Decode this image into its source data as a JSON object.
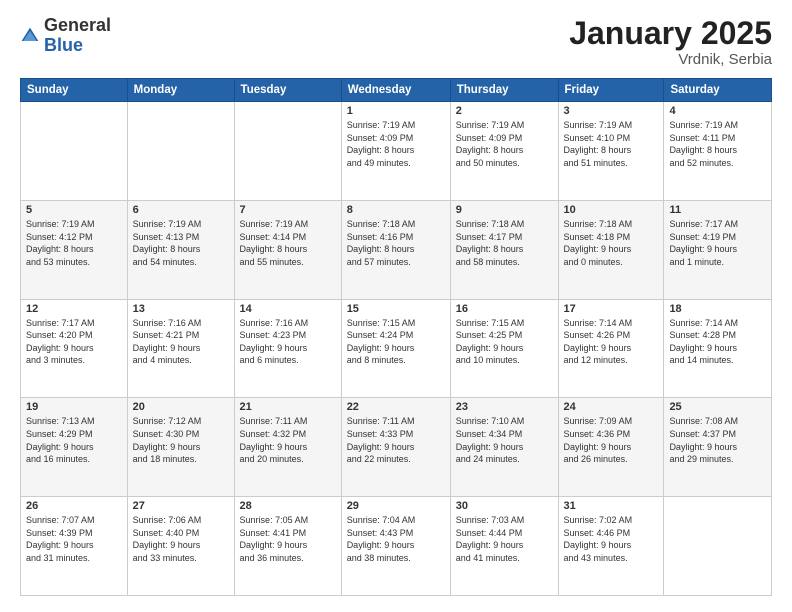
{
  "logo": {
    "general": "General",
    "blue": "Blue"
  },
  "header": {
    "month": "January 2025",
    "location": "Vrdnik, Serbia"
  },
  "weekdays": [
    "Sunday",
    "Monday",
    "Tuesday",
    "Wednesday",
    "Thursday",
    "Friday",
    "Saturday"
  ],
  "weeks": [
    [
      {
        "day": "",
        "info": ""
      },
      {
        "day": "",
        "info": ""
      },
      {
        "day": "",
        "info": ""
      },
      {
        "day": "1",
        "info": "Sunrise: 7:19 AM\nSunset: 4:09 PM\nDaylight: 8 hours\nand 49 minutes."
      },
      {
        "day": "2",
        "info": "Sunrise: 7:19 AM\nSunset: 4:09 PM\nDaylight: 8 hours\nand 50 minutes."
      },
      {
        "day": "3",
        "info": "Sunrise: 7:19 AM\nSunset: 4:10 PM\nDaylight: 8 hours\nand 51 minutes."
      },
      {
        "day": "4",
        "info": "Sunrise: 7:19 AM\nSunset: 4:11 PM\nDaylight: 8 hours\nand 52 minutes."
      }
    ],
    [
      {
        "day": "5",
        "info": "Sunrise: 7:19 AM\nSunset: 4:12 PM\nDaylight: 8 hours\nand 53 minutes."
      },
      {
        "day": "6",
        "info": "Sunrise: 7:19 AM\nSunset: 4:13 PM\nDaylight: 8 hours\nand 54 minutes."
      },
      {
        "day": "7",
        "info": "Sunrise: 7:19 AM\nSunset: 4:14 PM\nDaylight: 8 hours\nand 55 minutes."
      },
      {
        "day": "8",
        "info": "Sunrise: 7:18 AM\nSunset: 4:16 PM\nDaylight: 8 hours\nand 57 minutes."
      },
      {
        "day": "9",
        "info": "Sunrise: 7:18 AM\nSunset: 4:17 PM\nDaylight: 8 hours\nand 58 minutes."
      },
      {
        "day": "10",
        "info": "Sunrise: 7:18 AM\nSunset: 4:18 PM\nDaylight: 9 hours\nand 0 minutes."
      },
      {
        "day": "11",
        "info": "Sunrise: 7:17 AM\nSunset: 4:19 PM\nDaylight: 9 hours\nand 1 minute."
      }
    ],
    [
      {
        "day": "12",
        "info": "Sunrise: 7:17 AM\nSunset: 4:20 PM\nDaylight: 9 hours\nand 3 minutes."
      },
      {
        "day": "13",
        "info": "Sunrise: 7:16 AM\nSunset: 4:21 PM\nDaylight: 9 hours\nand 4 minutes."
      },
      {
        "day": "14",
        "info": "Sunrise: 7:16 AM\nSunset: 4:23 PM\nDaylight: 9 hours\nand 6 minutes."
      },
      {
        "day": "15",
        "info": "Sunrise: 7:15 AM\nSunset: 4:24 PM\nDaylight: 9 hours\nand 8 minutes."
      },
      {
        "day": "16",
        "info": "Sunrise: 7:15 AM\nSunset: 4:25 PM\nDaylight: 9 hours\nand 10 minutes."
      },
      {
        "day": "17",
        "info": "Sunrise: 7:14 AM\nSunset: 4:26 PM\nDaylight: 9 hours\nand 12 minutes."
      },
      {
        "day": "18",
        "info": "Sunrise: 7:14 AM\nSunset: 4:28 PM\nDaylight: 9 hours\nand 14 minutes."
      }
    ],
    [
      {
        "day": "19",
        "info": "Sunrise: 7:13 AM\nSunset: 4:29 PM\nDaylight: 9 hours\nand 16 minutes."
      },
      {
        "day": "20",
        "info": "Sunrise: 7:12 AM\nSunset: 4:30 PM\nDaylight: 9 hours\nand 18 minutes."
      },
      {
        "day": "21",
        "info": "Sunrise: 7:11 AM\nSunset: 4:32 PM\nDaylight: 9 hours\nand 20 minutes."
      },
      {
        "day": "22",
        "info": "Sunrise: 7:11 AM\nSunset: 4:33 PM\nDaylight: 9 hours\nand 22 minutes."
      },
      {
        "day": "23",
        "info": "Sunrise: 7:10 AM\nSunset: 4:34 PM\nDaylight: 9 hours\nand 24 minutes."
      },
      {
        "day": "24",
        "info": "Sunrise: 7:09 AM\nSunset: 4:36 PM\nDaylight: 9 hours\nand 26 minutes."
      },
      {
        "day": "25",
        "info": "Sunrise: 7:08 AM\nSunset: 4:37 PM\nDaylight: 9 hours\nand 29 minutes."
      }
    ],
    [
      {
        "day": "26",
        "info": "Sunrise: 7:07 AM\nSunset: 4:39 PM\nDaylight: 9 hours\nand 31 minutes."
      },
      {
        "day": "27",
        "info": "Sunrise: 7:06 AM\nSunset: 4:40 PM\nDaylight: 9 hours\nand 33 minutes."
      },
      {
        "day": "28",
        "info": "Sunrise: 7:05 AM\nSunset: 4:41 PM\nDaylight: 9 hours\nand 36 minutes."
      },
      {
        "day": "29",
        "info": "Sunrise: 7:04 AM\nSunset: 4:43 PM\nDaylight: 9 hours\nand 38 minutes."
      },
      {
        "day": "30",
        "info": "Sunrise: 7:03 AM\nSunset: 4:44 PM\nDaylight: 9 hours\nand 41 minutes."
      },
      {
        "day": "31",
        "info": "Sunrise: 7:02 AM\nSunset: 4:46 PM\nDaylight: 9 hours\nand 43 minutes."
      },
      {
        "day": "",
        "info": ""
      }
    ]
  ]
}
